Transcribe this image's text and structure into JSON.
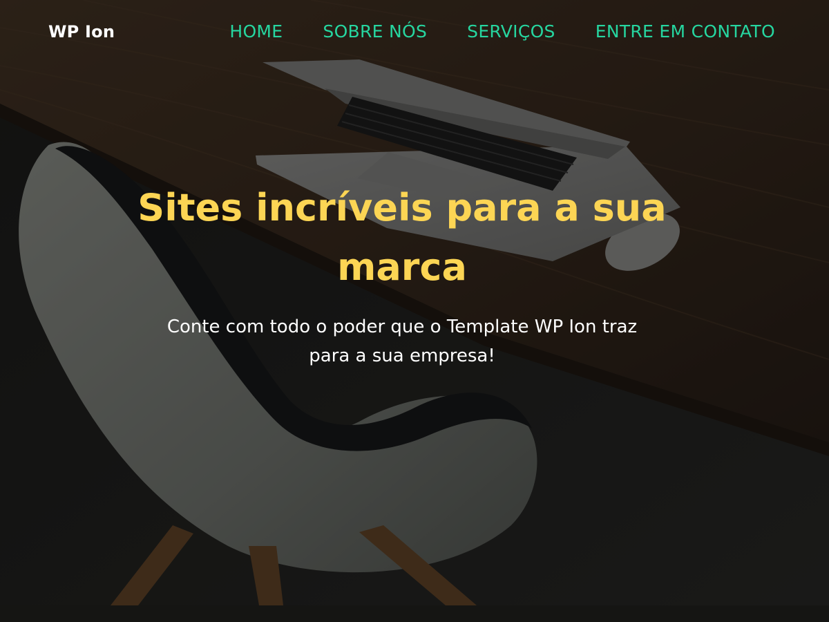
{
  "header": {
    "brand": "WP Ion",
    "nav": [
      {
        "label": "HOME"
      },
      {
        "label": "SOBRE NÓS"
      },
      {
        "label": "SERVIÇOS"
      },
      {
        "label": "ENTRE EM CONTATO"
      }
    ],
    "nav_color": "#26d6a0"
  },
  "hero": {
    "title": "Sites incríveis para a sua marca",
    "subtitle": "Conte com todo o poder que o Template WP Ion traz para a sua empresa!",
    "title_color": "#fcd554",
    "background_image": "dark wooden desk with a silver laptop, mouse and a white modern chair"
  }
}
